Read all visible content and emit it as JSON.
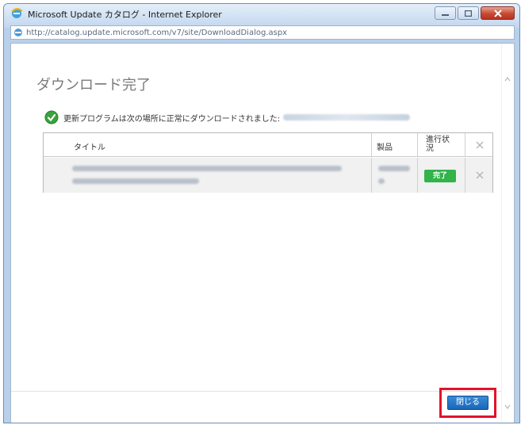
{
  "window": {
    "title": "Microsoft Update カタログ - Internet Explorer",
    "url": "http://catalog.update.microsoft.com/v7/site/DownloadDialog.aspx",
    "controls": {
      "minimize_icon": "minimize-icon",
      "maximize_icon": "maximize-icon",
      "close_icon": "close-icon"
    }
  },
  "dialog": {
    "title": "ダウンロード完了",
    "status_message": "更新プログラムは次の場所に正常にダウンロードされました:",
    "status_icon": "success-check-icon"
  },
  "table": {
    "columns": [
      "タイトル",
      "製品",
      "進行状況"
    ],
    "rows": [
      {
        "status": "完了"
      }
    ]
  },
  "footer": {
    "close_label": "閉じる"
  },
  "colors": {
    "accent": "#1866b8",
    "success": "#32b34b",
    "highlight": "#e3122a"
  }
}
